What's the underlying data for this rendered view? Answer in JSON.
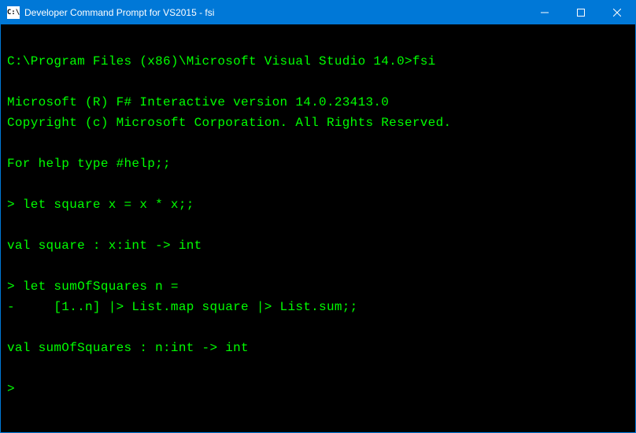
{
  "window": {
    "title": "Developer Command Prompt for VS2015 - fsi",
    "icon_label": "C:\\"
  },
  "terminal": {
    "lines": [
      "",
      "C:\\Program Files (x86)\\Microsoft Visual Studio 14.0>fsi",
      "",
      "Microsoft (R) F# Interactive version 14.0.23413.0",
      "Copyright (c) Microsoft Corporation. All Rights Reserved.",
      "",
      "For help type #help;;",
      "",
      "> let square x = x * x;;",
      "",
      "val square : x:int -> int",
      "",
      "> let sumOfSquares n =",
      "-     [1..n] |> List.map square |> List.sum;;",
      "",
      "val sumOfSquares : n:int -> int",
      "",
      ">"
    ]
  }
}
